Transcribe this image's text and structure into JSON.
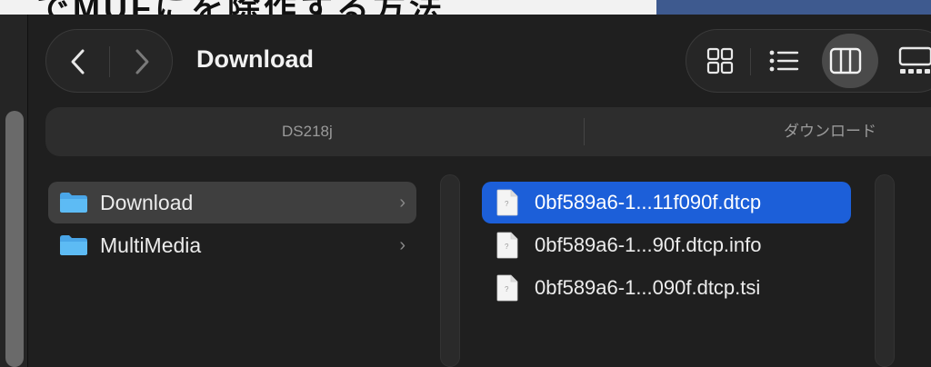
{
  "title": "Download",
  "topstrip_text": "でMUFにを除作する方法",
  "pathbar": {
    "segments": [
      "DS218j",
      "ダウンロード"
    ]
  },
  "sidebar_folders": [
    {
      "label": "Download",
      "selected": true
    },
    {
      "label": "MultiMedia",
      "selected": false
    }
  ],
  "files": [
    {
      "label": "0bf589a6-1...11f090f.dtcp",
      "selected": true
    },
    {
      "label": "0bf589a6-1...90f.dtcp.info",
      "selected": false
    },
    {
      "label": "0bf589a6-1...090f.dtcp.tsi",
      "selected": false
    }
  ],
  "view_modes": [
    {
      "name": "icon-view",
      "active": false
    },
    {
      "name": "list-view",
      "active": false
    },
    {
      "name": "column-view",
      "active": true
    },
    {
      "name": "gallery-view",
      "active": false
    }
  ],
  "icons": {
    "back": "chevron-left-icon",
    "forward": "chevron-right-icon",
    "folder": "folder-icon",
    "file": "document-icon",
    "disclosure": "chevron-right-icon"
  },
  "colors": {
    "selection_blue": "#1c5fd9",
    "folder_blue": "#56b3f0",
    "row_highlight": "#3f3f3f"
  }
}
